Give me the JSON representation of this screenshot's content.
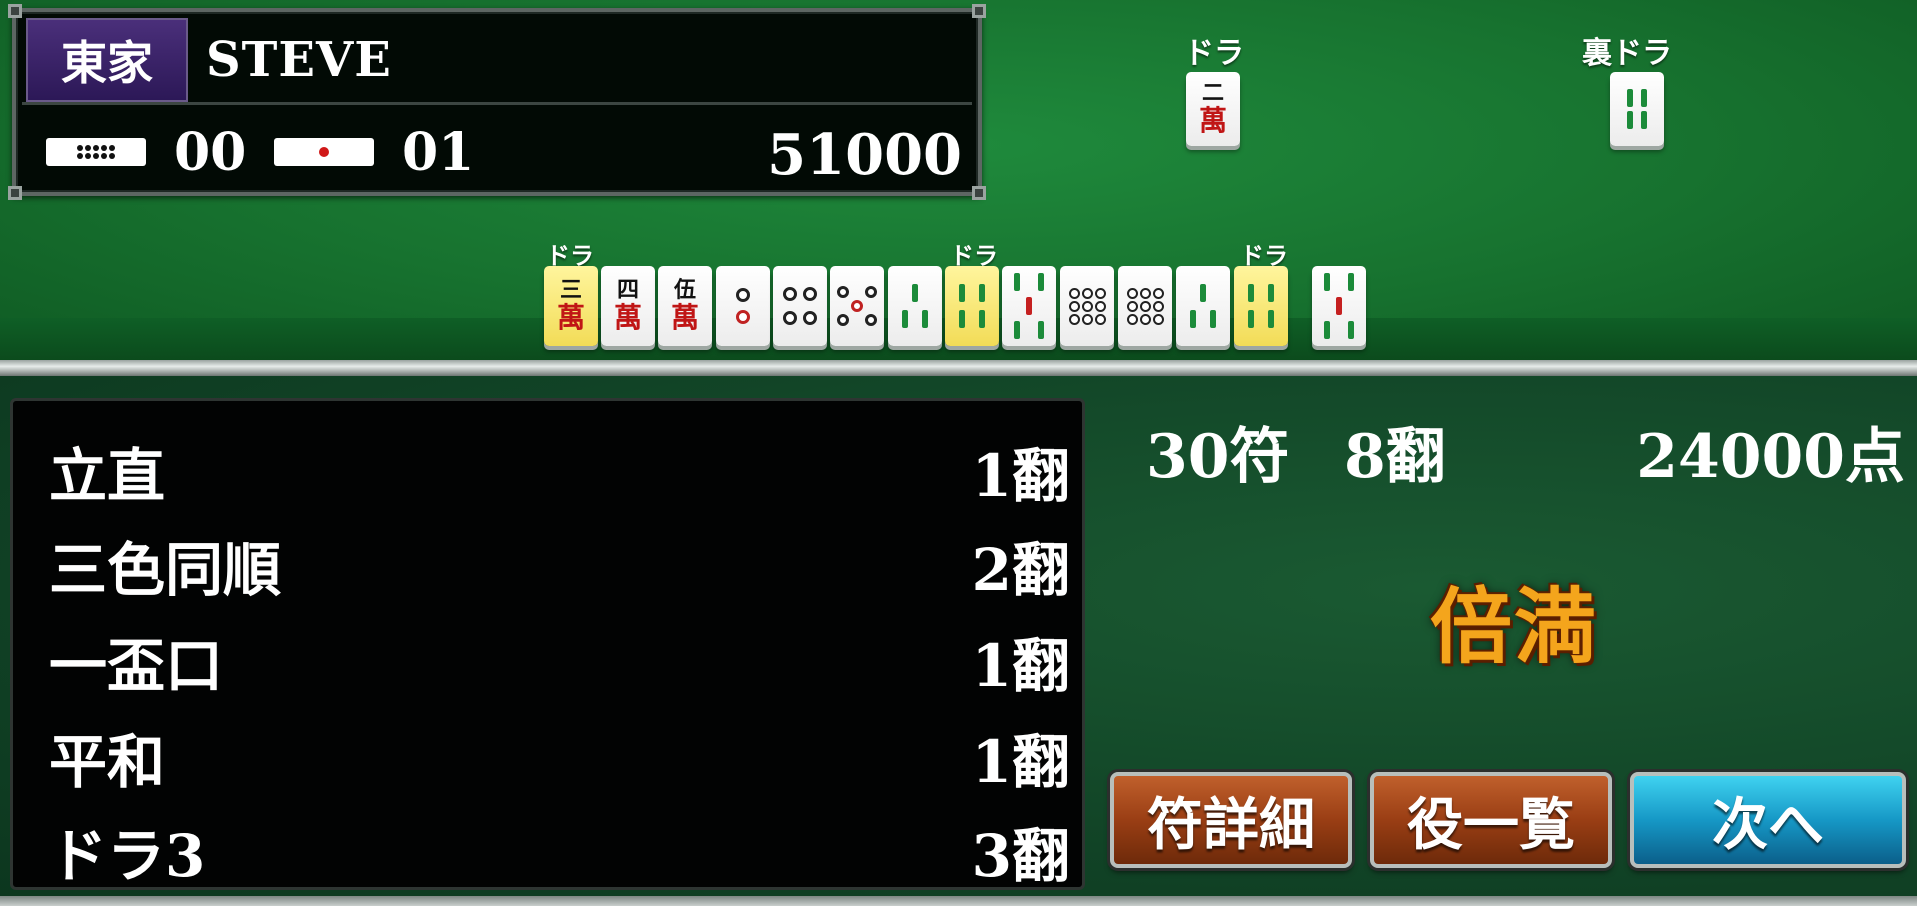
{
  "player": {
    "seat": "東家",
    "name": "STEVE",
    "honba_count": "00",
    "riichi_count": "01",
    "score": "51000"
  },
  "indicators": {
    "dora_label": "ドラ",
    "ura_dora_label": "裏ドラ",
    "dora_tile": "2-man",
    "ura_dora_tile": "4-sou"
  },
  "hand": {
    "tiles": [
      "3-man (dora)",
      "4-man",
      "5-man",
      "2-pin",
      "4-pin",
      "5-pin",
      "3-sou",
      "4-sou (dora)",
      "5-sou",
      "8-pin",
      "8-pin",
      "3-sou",
      "4-sou (dora)",
      "5-sou (winning)"
    ],
    "dora_tag": "ドラ"
  },
  "tile_text": {
    "man": "萬",
    "san": "三",
    "shi": "四",
    "go": "伍",
    "ni": "二"
  },
  "yaku": [
    {
      "name": "立直",
      "han": "1翻"
    },
    {
      "name": "三色同順",
      "han": "2翻"
    },
    {
      "name": "一盃口",
      "han": "1翻"
    },
    {
      "name": "平和",
      "han": "1翻"
    },
    {
      "name": "ドラ3",
      "han": "3翻"
    }
  ],
  "result": {
    "fu": "30符",
    "han": "8翻",
    "points": "24000点",
    "limit": "倍満"
  },
  "buttons": {
    "fu_detail": "符詳細",
    "yaku_list": "役一覧",
    "next": "次へ"
  },
  "colors": {
    "table_green": "#17722f",
    "dora_highlight": "#f2dc57",
    "limit_orange": "#f4a51c",
    "button_brown": "#9a3e14",
    "button_blue": "#1698c6",
    "seat_purple": "#3b2268"
  }
}
